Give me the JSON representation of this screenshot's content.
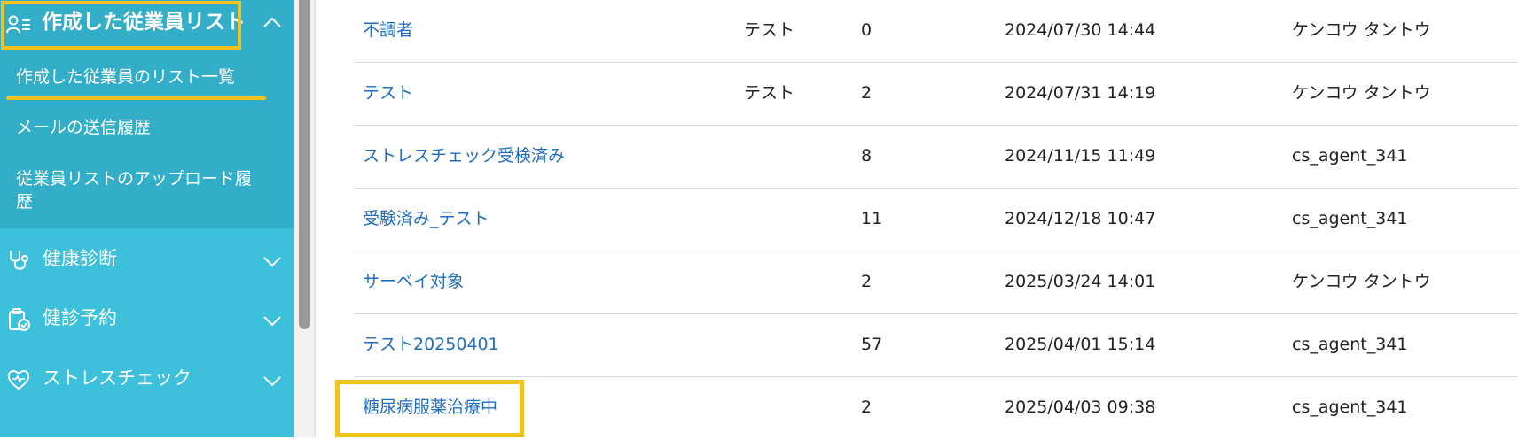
{
  "sidebar": {
    "employee_list_section": {
      "title": "作成した従業員リスト",
      "icon": "user-list-icon",
      "expanded": true,
      "items": [
        {
          "label": "作成した従業員のリスト一覧",
          "active": true
        },
        {
          "label": "メールの送信履歴",
          "active": false
        },
        {
          "label": "従業員リストのアップロード履",
          "label_line2": "歴",
          "active": false
        }
      ]
    },
    "nav": [
      {
        "label": "健康診断",
        "icon": "stethoscope-icon"
      },
      {
        "label": "健診予約",
        "icon": "clipboard-check-icon"
      },
      {
        "label": "ストレスチェック",
        "icon": "heart-icon"
      }
    ]
  },
  "table": {
    "rows": [
      {
        "name": "不調者",
        "description": "テスト",
        "count": "0",
        "created": "2024/07/30 14:44",
        "creator": "ケンコウ タントウ"
      },
      {
        "name": "テスト",
        "description": "テスト",
        "count": "2",
        "created": "2024/07/31 14:19",
        "creator": "ケンコウ タントウ"
      },
      {
        "name": "ストレスチェック受検済み",
        "description": "",
        "count": "8",
        "created": "2024/11/15 11:49",
        "creator": "cs_agent_341"
      },
      {
        "name": "受験済み_テスト",
        "description": "",
        "count": "11",
        "created": "2024/12/18 10:47",
        "creator": "cs_agent_341"
      },
      {
        "name": "サーベイ対象",
        "description": "",
        "count": "2",
        "created": "2025/03/24 14:01",
        "creator": "ケンコウ タントウ"
      },
      {
        "name": "テスト20250401",
        "description": "",
        "count": "57",
        "created": "2025/04/01 15:14",
        "creator": "cs_agent_341"
      },
      {
        "name": "糖尿病服薬治療中",
        "description": "",
        "count": "2",
        "created": "2025/04/03 09:38",
        "creator": "cs_agent_341"
      }
    ]
  },
  "colors": {
    "sidebar_bg": "#3cc0dc",
    "sidebar_section_bg": "#33aec8",
    "highlight": "#f5c21b",
    "link": "#1f6dbf"
  }
}
